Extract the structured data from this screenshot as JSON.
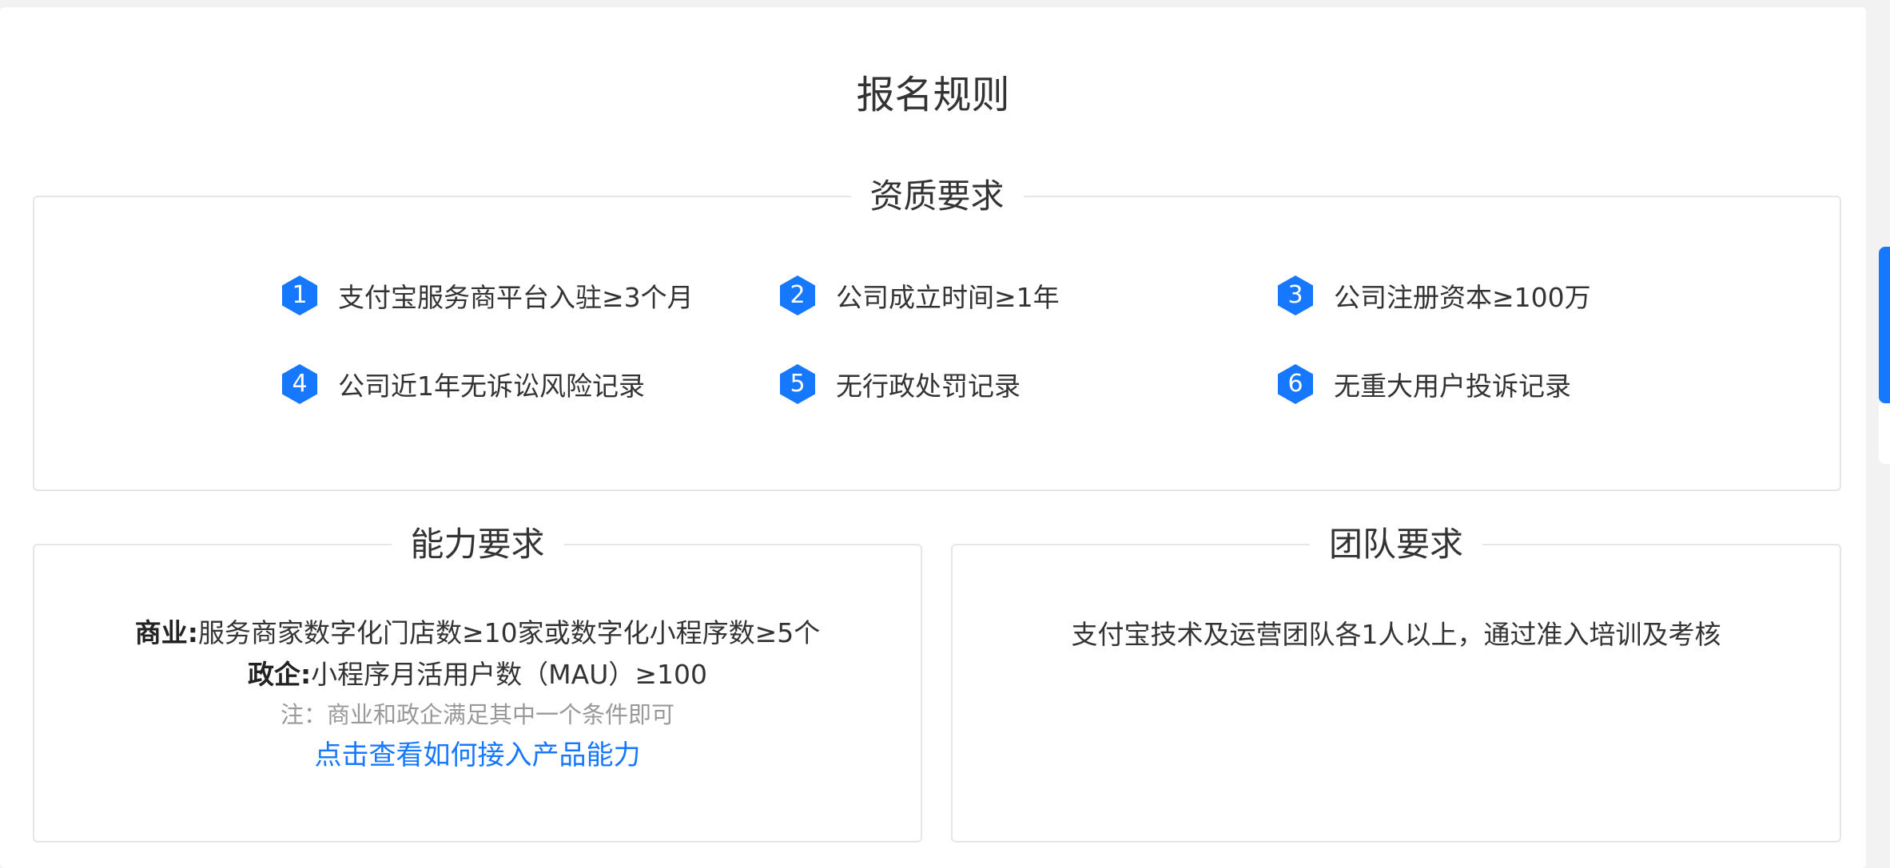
{
  "page": {
    "title": "报名规则"
  },
  "qualification": {
    "title": "资质要求",
    "items": [
      {
        "num": "1",
        "text": "支付宝服务商平台入驻≥3个月"
      },
      {
        "num": "2",
        "text": "公司成立时间≥1年"
      },
      {
        "num": "3",
        "text": "公司注册资本≥100万"
      },
      {
        "num": "4",
        "text": "公司近1年无诉讼风险记录"
      },
      {
        "num": "5",
        "text": "无行政处罚记录"
      },
      {
        "num": "6",
        "text": "无重大用户投诉记录"
      }
    ]
  },
  "ability": {
    "title": "能力要求",
    "commercial_label": "商业:",
    "commercial_text": "服务商家数字化门店数≥10家或数字化小程序数≥5个",
    "gov_label": "政企:",
    "gov_text": "小程序月活用户数（MAU）≥100",
    "note": "注：商业和政企满足其中一个条件即可",
    "link_label": "点击查看如何接入产品能力"
  },
  "team": {
    "title": "团队要求",
    "text": "支付宝技术及运营团队各1人以上，通过准入培训及考核"
  },
  "colors": {
    "accent": "#1677ff",
    "text": "#333333",
    "muted": "#999999",
    "border": "#e6e6e6",
    "background": "#f2f2f2"
  }
}
